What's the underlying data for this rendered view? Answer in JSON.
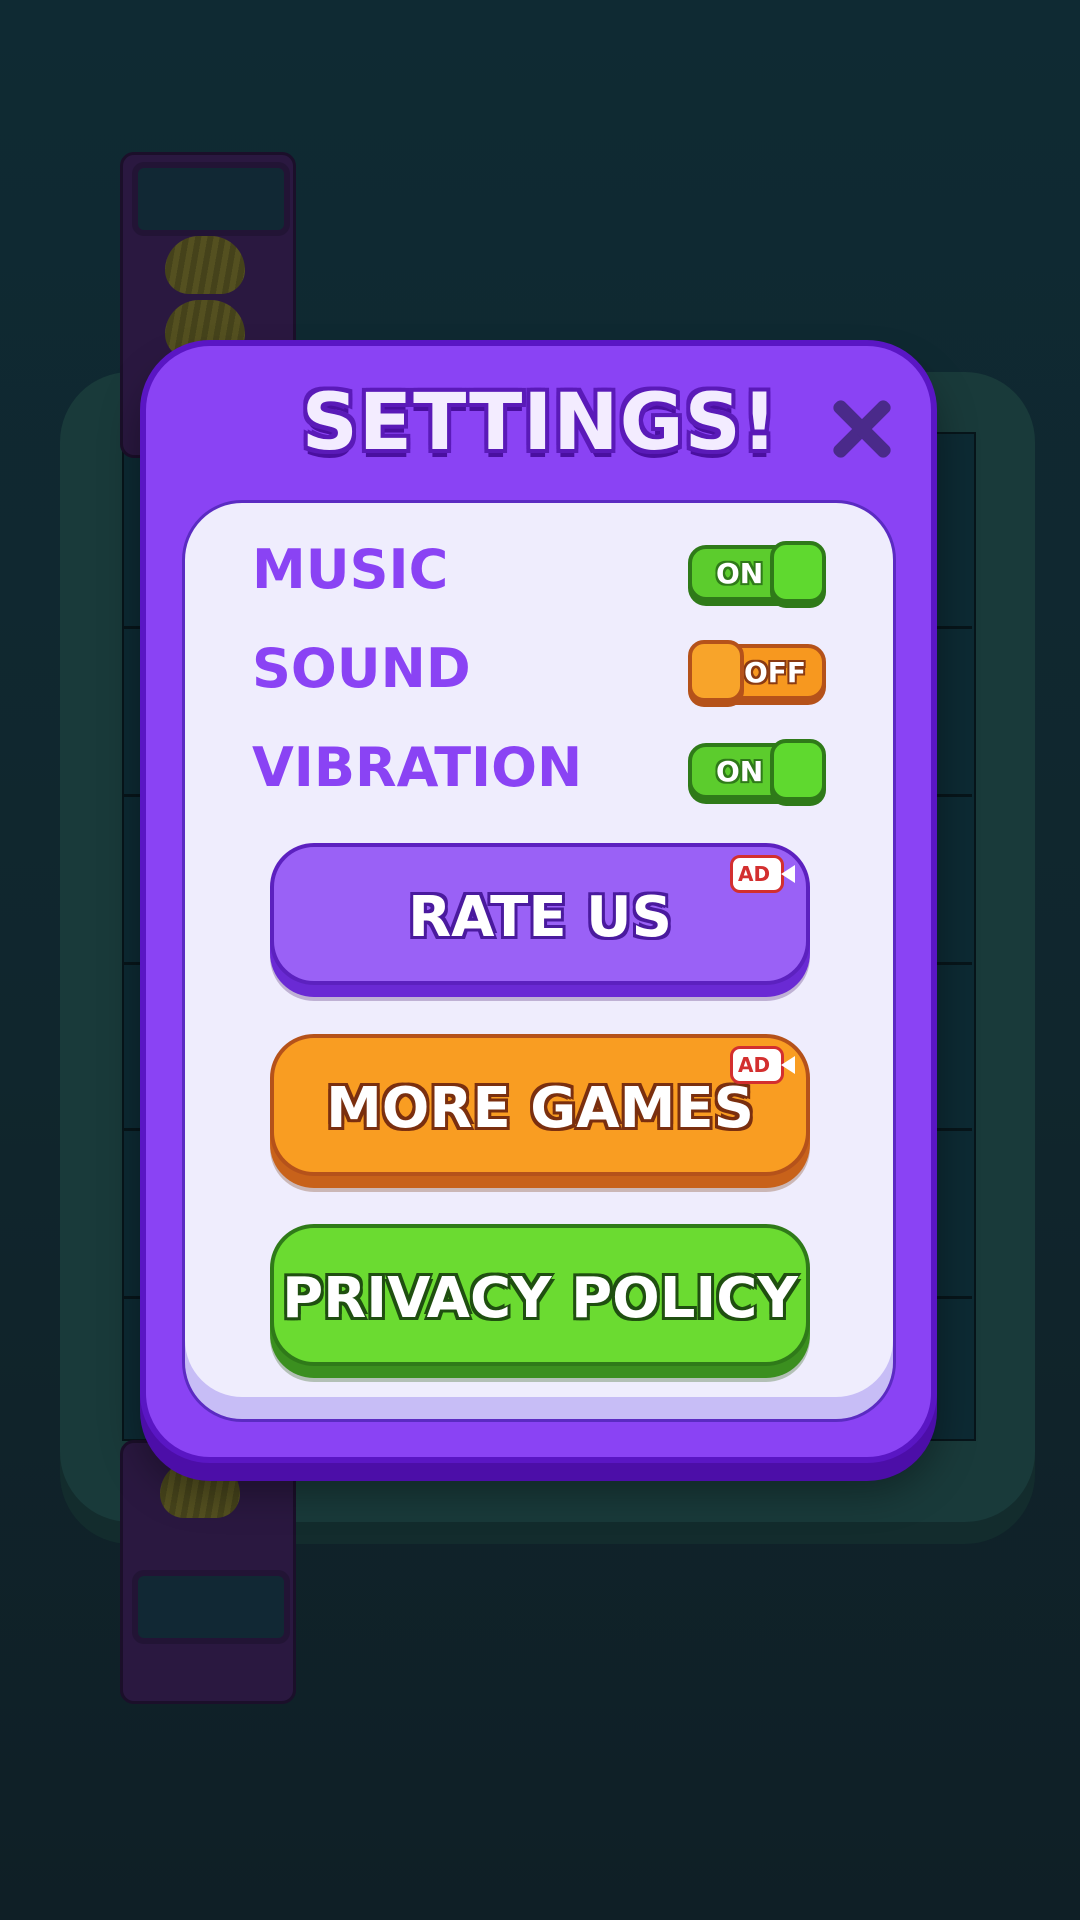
{
  "modal": {
    "title": "SETTINGS!",
    "close_icon": "close-x-icon"
  },
  "settings": [
    {
      "label": "MUSIC",
      "state": "ON",
      "on": true
    },
    {
      "label": "SOUND",
      "state": "OFF",
      "on": false
    },
    {
      "label": "VIBRATION",
      "state": "ON",
      "on": true
    }
  ],
  "buttons": {
    "rate_us": {
      "label": "RATE US",
      "badge": "AD"
    },
    "more_games": {
      "label": "MORE GAMES",
      "badge": "AD"
    },
    "privacy_policy": {
      "label": "PRIVACY POLICY"
    }
  },
  "colors": {
    "modal_purple": "#8a43f4",
    "toggle_on": "#5ccc2d",
    "toggle_off": "#f7981f",
    "rate_button": "#9a61f6",
    "more_games_button": "#f99d22",
    "privacy_button": "#6bdb31",
    "ad_badge": "#d32f2f"
  }
}
